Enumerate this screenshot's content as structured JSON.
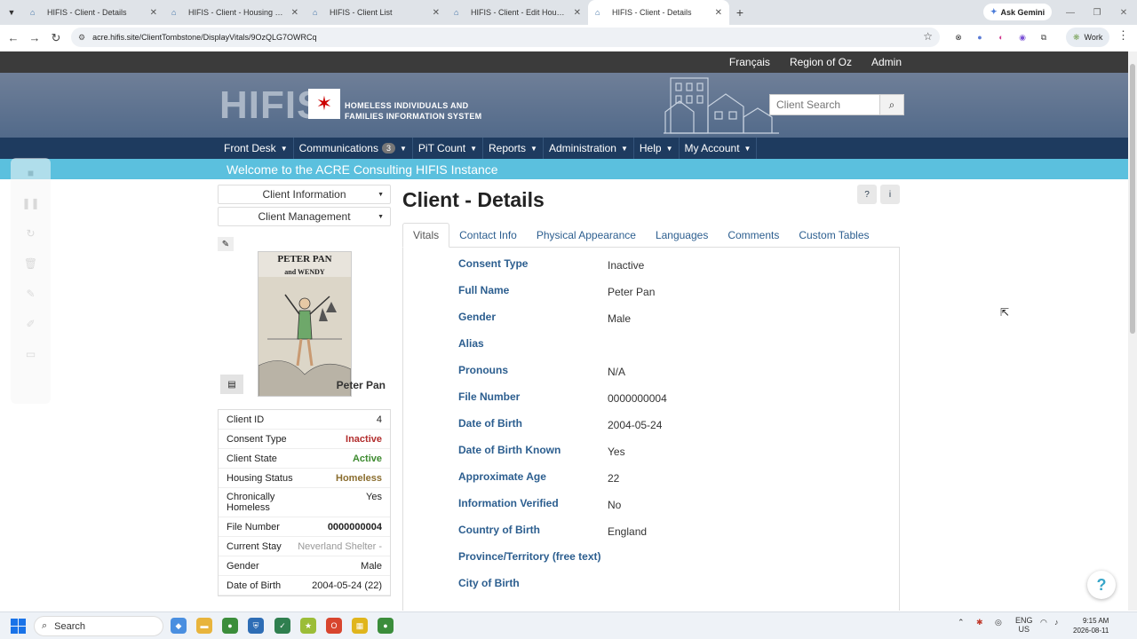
{
  "browser": {
    "tabs": [
      {
        "title": "HIFIS - Client - Details",
        "active": false
      },
      {
        "title": "HIFIS - Client - Housing History",
        "active": false
      },
      {
        "title": "HIFIS - Client List",
        "active": false
      },
      {
        "title": "HIFIS - Client - Edit Housing Hi",
        "active": false
      },
      {
        "title": "HIFIS - Client - Details",
        "active": true
      }
    ],
    "ask_gemini": "Ask Gemini",
    "url": "acre.hifis.site/ClientTombstone/DisplayVitals/9OzQLG7OWRCq",
    "profile": "Work"
  },
  "site": {
    "top_links": [
      "Français",
      "Region of Oz",
      "Admin"
    ],
    "logo": "HIFIS",
    "logo_sub_1": "HOMELESS INDIVIDUALS AND",
    "logo_sub_2": "FAMILIES INFORMATION SYSTEM",
    "search_placeholder": "Client Search",
    "nav": [
      {
        "label": "Front Desk",
        "badge": ""
      },
      {
        "label": "Communications",
        "badge": "3"
      },
      {
        "label": "PiT Count",
        "badge": ""
      },
      {
        "label": "Reports",
        "badge": ""
      },
      {
        "label": "Administration",
        "badge": ""
      },
      {
        "label": "Help",
        "badge": ""
      },
      {
        "label": "My Account",
        "badge": ""
      }
    ],
    "welcome": "Welcome to the ACRE Consulting HIFIS Instance"
  },
  "left": {
    "client_information": "Client Information",
    "client_management": "Client Management",
    "book_title_1": "PETER PAN",
    "book_title_2": "and WENDY",
    "photo_name": "Peter Pan",
    "rows": [
      {
        "label": "Client ID",
        "value": "4",
        "style": ""
      },
      {
        "label": "Consent Type",
        "value": "Inactive",
        "style": "red"
      },
      {
        "label": "Client State",
        "value": "Active",
        "style": "green"
      },
      {
        "label": "Housing Status",
        "value": "Homeless",
        "style": "olive"
      },
      {
        "label": "Chronically Homeless",
        "value": "Yes",
        "style": ""
      },
      {
        "label": "File Number",
        "value": "0000000004",
        "style": "bold"
      },
      {
        "label": "Current Stay",
        "value": "Neverland Shelter -",
        "style": "muted"
      },
      {
        "label": "Gender",
        "value": "Male",
        "style": ""
      },
      {
        "label": "Date of Birth",
        "value": "2004-05-24 (22)",
        "style": ""
      }
    ]
  },
  "main": {
    "title": "Client - Details",
    "tabs": [
      "Vitals",
      "Contact Info",
      "Physical Appearance",
      "Languages",
      "Comments",
      "Custom Tables"
    ],
    "fields": [
      {
        "label": "Consent Type",
        "value": "Inactive"
      },
      {
        "label": "Full Name",
        "value": "Peter Pan"
      },
      {
        "label": "Gender",
        "value": "Male"
      },
      {
        "label": "Alias",
        "value": ""
      },
      {
        "label": "Pronouns",
        "value": "N/A"
      },
      {
        "label": "File Number",
        "value": "0000000004"
      },
      {
        "label": "Date of Birth",
        "value": "2004-05-24"
      },
      {
        "label": "Date of Birth Known",
        "value": "Yes"
      },
      {
        "label": "Approximate Age",
        "value": "22"
      },
      {
        "label": "Information Verified",
        "value": "No"
      },
      {
        "label": "Country of Birth",
        "value": "England"
      },
      {
        "label": "Province/Territory (free text)",
        "value": ""
      },
      {
        "label": "City of Birth",
        "value": ""
      }
    ]
  },
  "taskbar": {
    "search": "Search",
    "lang_1": "ENG",
    "lang_2": "US",
    "time": "9:15 AM",
    "date": "2026-08-11"
  }
}
